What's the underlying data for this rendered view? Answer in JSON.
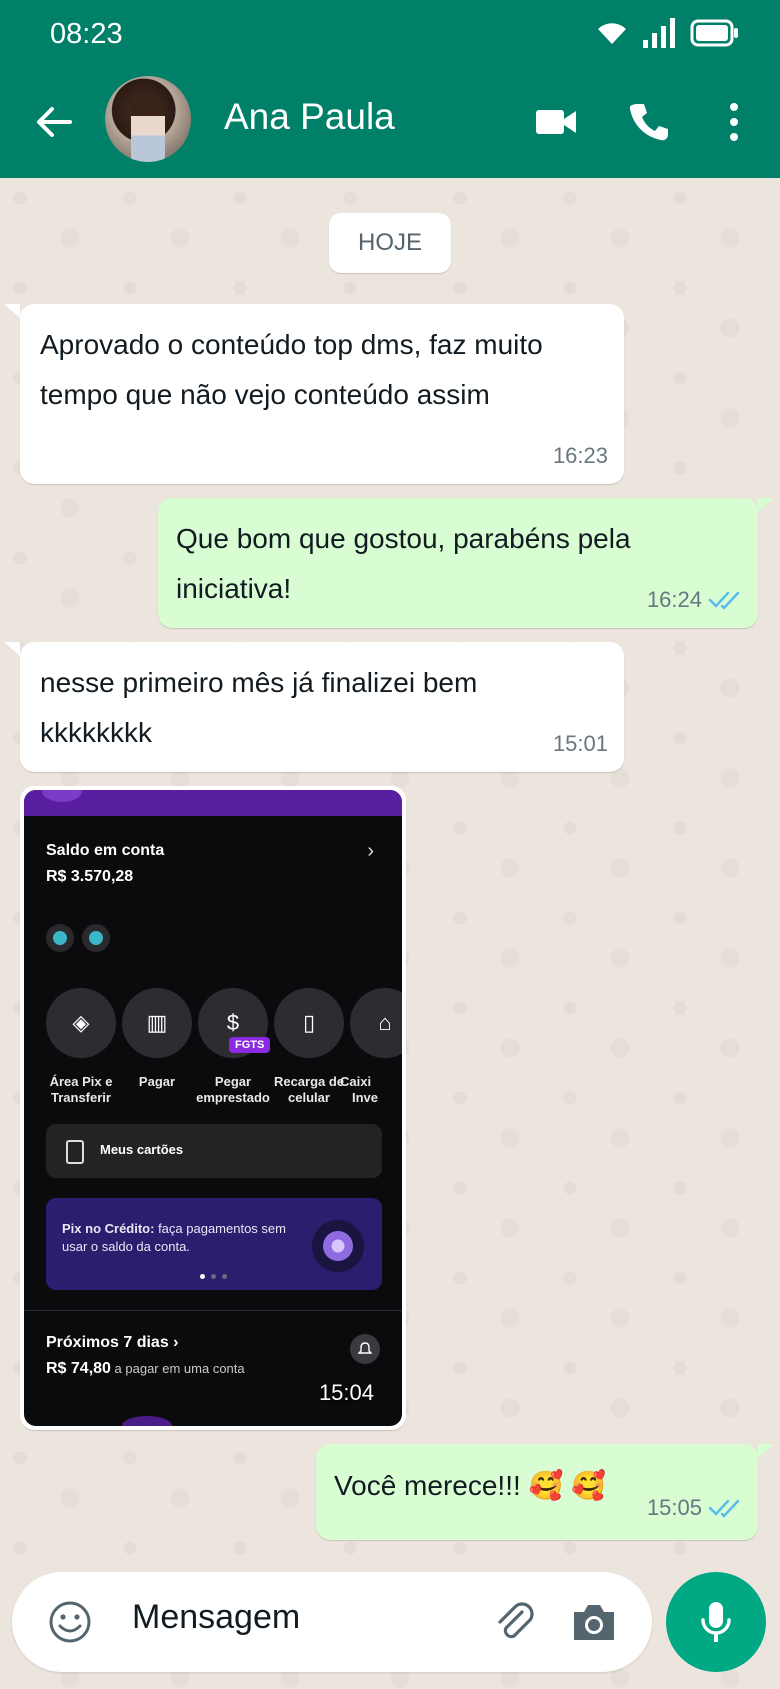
{
  "status_bar": {
    "time": "08:23"
  },
  "header": {
    "contact_name": "Ana Paula"
  },
  "chat": {
    "date_chip": "HOJE",
    "messages": [
      {
        "direction": "in",
        "text_lines": [
          "Aprovado o conteúdo top dms, faz muito",
          "tempo que não vejo conteúdo assim"
        ],
        "time": "16:23"
      },
      {
        "direction": "out",
        "text_lines": [
          "Que bom que gostou, parabéns pela",
          "iniciativa!"
        ],
        "time": "16:24",
        "read": true
      },
      {
        "direction": "in",
        "text_lines": [
          "nesse primeiro mês já finalizei bem",
          "kkkkkkkk"
        ],
        "time": "15:01"
      },
      {
        "direction": "in",
        "type": "image",
        "time": "15:04"
      },
      {
        "direction": "out",
        "text": "Você merece!!! 🥰 🥰",
        "time": "15:05",
        "read": true
      }
    ]
  },
  "screenshot_image": {
    "balance_label": "Saldo em conta",
    "balance_value": "R$ 3.570,28",
    "actions": [
      {
        "line1": "Área Pix e",
        "line2": "Transferir"
      },
      {
        "line1": "Pagar",
        "line2": ""
      },
      {
        "line1": "Pegar",
        "line2": "emprestado"
      },
      {
        "line1": "Recarga de",
        "line2": "celular"
      },
      {
        "line1": "Caixi",
        "line2": "Inve"
      }
    ],
    "fgts_badge": "FGTS",
    "cards_label": "Meus cartões",
    "pix_bold": "Pix no Crédito:",
    "pix_text": " faça pagamentos sem usar o saldo da conta.",
    "next_days": "Próximos 7 dias ›",
    "next_amount": "R$ 74,80",
    "next_note": " a pagar em uma conta"
  },
  "input": {
    "placeholder": "Mensagem"
  },
  "colors": {
    "header": "#008069",
    "outgoing": "#d9fdd3",
    "mic": "#00a884",
    "read_ticks": "#53bdeb"
  }
}
